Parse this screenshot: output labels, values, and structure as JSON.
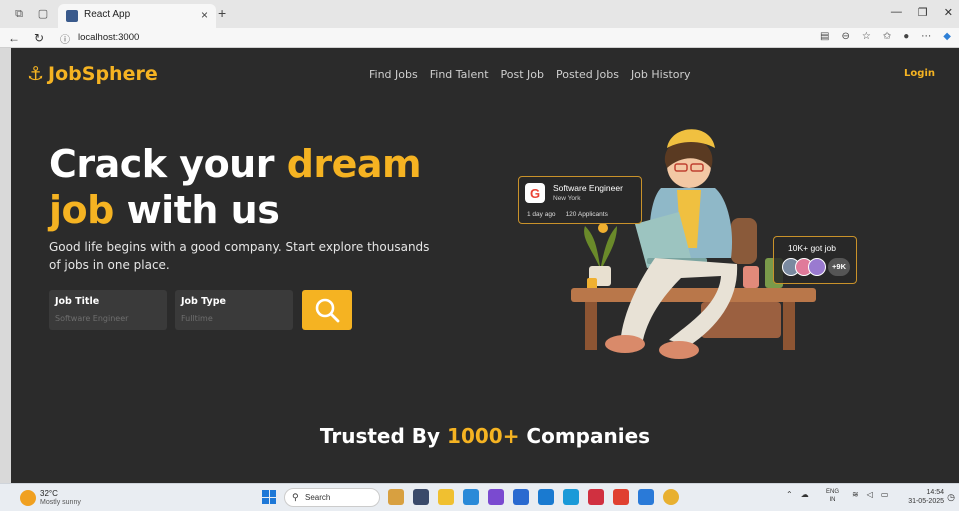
{
  "browser": {
    "tab_title": "React App",
    "tab_close": "×",
    "new_tab": "+",
    "url": "localhost:3000"
  },
  "header": {
    "logo": "JobSphere",
    "nav": [
      "Find Jobs",
      "Find Talent",
      "Post Job",
      "Posted Jobs",
      "Job History"
    ],
    "login": "Login"
  },
  "hero": {
    "line1_a": "Crack your ",
    "line1_b": "dream",
    "line2_a": "job",
    "line2_b": " with us",
    "subtext": "Good life begins with a good company. Start explore thousands of jobs in one place."
  },
  "search": {
    "job_title_label": "Job Title",
    "job_title_placeholder": "Software Engineer",
    "job_type_label": "Job Type",
    "job_type_placeholder": "Fulltime"
  },
  "job_card": {
    "company_letter": "G",
    "title": "Software Engineer",
    "location": "New York",
    "posted": "1 day ago",
    "applicants": "120 Applicants"
  },
  "got_job_card": {
    "text": "10K+ got job",
    "count": "+9K"
  },
  "trusted": {
    "a": "Trusted By ",
    "b": "1000+",
    "c": " Companies"
  },
  "taskbar": {
    "temp": "32°C",
    "condition": "Mostly sunny",
    "search": "Search",
    "lang1": "ENG",
    "lang2": "IN",
    "time": "14:54",
    "date": "31-05-2025"
  },
  "colors": {
    "accent": "#f5b322",
    "background": "#2b2b2b"
  }
}
